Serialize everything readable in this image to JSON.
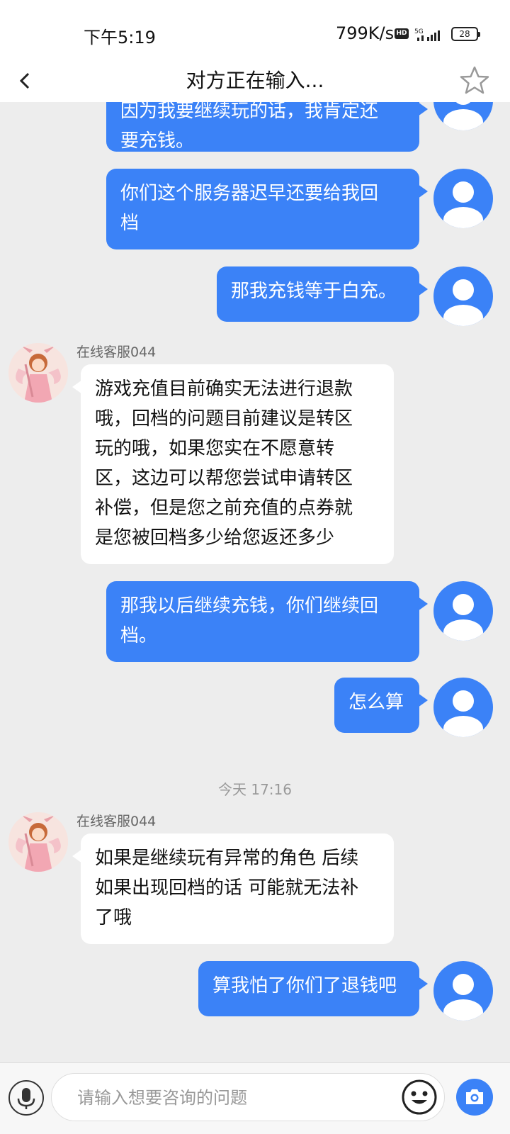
{
  "status_bar": {
    "time": "下午5:19",
    "speed": "799K/s",
    "hd_badge": "HD",
    "network": "5G",
    "battery": "28"
  },
  "nav": {
    "title": "对方正在输入...",
    "back_icon": "chevron-left-icon",
    "favorite_icon": "star-outline-icon"
  },
  "colors": {
    "user_bubble": "#3b82f7",
    "agent_bubble": "#ffffff",
    "chat_background": "#ededed",
    "accent": "#3b82f7"
  },
  "messages": [
    {
      "sender": "user",
      "lines": [
        "因为我要继续玩的话，我肯定还",
        "要充钱。"
      ]
    },
    {
      "sender": "user",
      "lines": [
        "你们这个服务器迟早还要给我回",
        "档"
      ]
    },
    {
      "sender": "user",
      "lines": [
        "那我充钱等于白充。"
      ]
    },
    {
      "sender": "agent",
      "name": "在线客服044",
      "lines": [
        "游戏充值目前确实无法进行退款",
        "哦，回档的问题目前建议是转区",
        "玩的哦，如果您实在不愿意转",
        "区，这边可以帮您尝试申请转区",
        "补偿，但是您之前充值的点券就",
        "是您被回档多少给您返还多少"
      ]
    },
    {
      "sender": "user",
      "lines": [
        "那我以后继续充钱，你们继续回",
        "档。"
      ]
    },
    {
      "sender": "user",
      "lines": [
        "怎么算"
      ]
    },
    {
      "sender": "agent",
      "name": "在线客服044",
      "lines": [
        "如果是继续玩有异常的角色  后续",
        "如果出现回档的话  可能就无法补",
        "了哦"
      ]
    },
    {
      "sender": "user",
      "lines": [
        "算我怕了你们了退钱吧"
      ]
    }
  ],
  "timestamp": "今天 17:16",
  "input_bar": {
    "placeholder": "请输入想要咨询的问题",
    "value": "",
    "mic_icon": "microphone-icon",
    "emoji_icon": "smiley-face-icon",
    "camera_icon": "camera-icon"
  }
}
